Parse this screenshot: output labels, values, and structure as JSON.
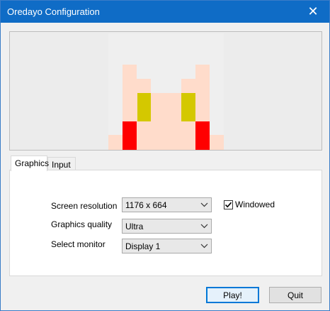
{
  "window": {
    "title": "Oredayo Configuration",
    "close_glyph": "✕"
  },
  "preview": {
    "image_icon": "character-face-pixel-art"
  },
  "tabs": [
    {
      "label": "Graphics",
      "active": true
    },
    {
      "label": "Input",
      "active": false
    }
  ],
  "graphics": {
    "resolution_label": "Screen resolution",
    "resolution_value": "1176 x 664",
    "quality_label": "Graphics quality",
    "quality_value": "Ultra",
    "monitor_label": "Select monitor",
    "monitor_value": "Display 1",
    "windowed_label": "Windowed",
    "windowed_checked": true
  },
  "buttons": {
    "play": "Play!",
    "quit": "Quit"
  },
  "colors": {
    "titlebar": "#0f6cc6",
    "skin": "#ffdccb",
    "eye": "#d4c800",
    "cheek": "#ff0000"
  }
}
